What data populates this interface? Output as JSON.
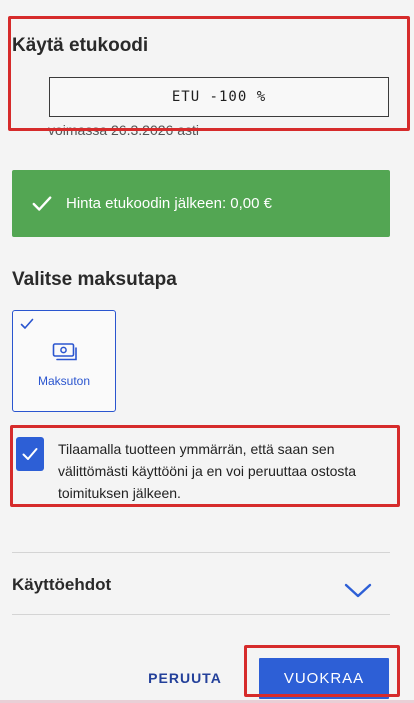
{
  "discount": {
    "title": "Käytä etukoodi",
    "code_value": "ETU -100 %",
    "validity": "voimassa 26.3.2026 asti"
  },
  "success_banner": {
    "icon": "checkmark-icon",
    "text": "Hinta etukoodin jälkeen: 0,00 €"
  },
  "payment": {
    "title": "Valitse maksutapa",
    "options": [
      {
        "label": "Maksuton",
        "icon": "cash-icon",
        "selected": true
      }
    ]
  },
  "consent": {
    "checked": true,
    "text": "Tilaamalla tuotteen ymmärrän, että saan sen välittömästi käyttööni ja en voi peruuttaa ostosta toimituksen jälkeen."
  },
  "terms": {
    "title": "Käyttöehdot",
    "icon": "chevron-down-icon"
  },
  "actions": {
    "cancel_label": "PERUUTA",
    "rent_label": "VUOKRAA"
  },
  "colors": {
    "accent": "#2d5fd6",
    "success": "#53a653",
    "highlight": "#d62b2b",
    "link": "#23409a"
  }
}
